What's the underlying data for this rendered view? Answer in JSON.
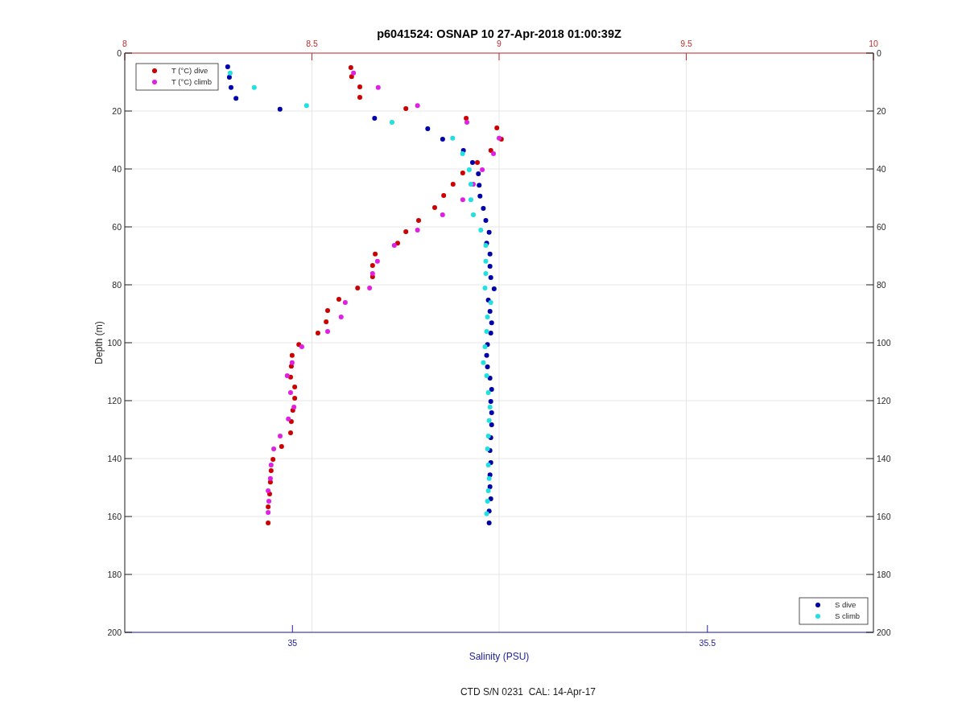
{
  "chart_data": {
    "type": "scatter",
    "grid": true,
    "legend": [
      "top-left",
      "bottom-right"
    ],
    "title": "p6041524: OSNAP 10 27-Apr-2018 01:00:39Z",
    "xlabel": "Salinity (PSU)",
    "ylabel": "Depth (m)",
    "xlim": [
      34.798,
      35.7
    ],
    "x2lim": [
      8,
      10
    ],
    "ylim": [
      200,
      0
    ],
    "xticks": [
      35,
      35.5
    ],
    "x2ticks": [
      8,
      8.5,
      9,
      9.5,
      10
    ],
    "yticks": [
      0,
      20,
      40,
      60,
      80,
      100,
      120,
      140,
      160,
      180,
      200
    ],
    "y2lim": [
      200,
      0
    ],
    "y2ticks": [
      0,
      20,
      40,
      60,
      80,
      100,
      120,
      140,
      160,
      180,
      200
    ],
    "series": [
      {
        "name": "T (°C) dive",
        "color": "#cc0000",
        "axis": "x2",
        "x": [
          8.604,
          8.606,
          8.628,
          8.628,
          8.751,
          8.912,
          8.994,
          9.006,
          8.978,
          8.942,
          8.903,
          8.877,
          8.852,
          8.828,
          8.785,
          8.751,
          8.729,
          8.669,
          8.662,
          8.662,
          8.622,
          8.572,
          8.542,
          8.538,
          8.516,
          8.465,
          8.447,
          8.445,
          8.443,
          8.454,
          8.454,
          8.449,
          8.445,
          8.443,
          8.419,
          8.396,
          8.391,
          8.389,
          8.387,
          8.383,
          8.383
        ],
        "values": [
          5.0,
          8.1,
          11.7,
          15.3,
          19.2,
          22.5,
          25.8,
          29.7,
          33.6,
          37.8,
          41.4,
          45.3,
          49.2,
          53.3,
          57.8,
          61.7,
          65.6,
          69.4,
          73.3,
          77.2,
          81.1,
          85.0,
          88.9,
          92.8,
          96.7,
          100.6,
          104.4,
          108.1,
          111.9,
          115.3,
          119.2,
          123.3,
          127.2,
          131.1,
          135.8,
          140.3,
          144.2,
          148.1,
          152.2,
          156.7,
          162.2
        ]
      },
      {
        "name": "T (°C) climb",
        "color": "#e020e0",
        "axis": "x2",
        "x": [
          8.611,
          8.677,
          8.782,
          8.914,
          9.0,
          8.985,
          8.955,
          8.931,
          8.903,
          8.849,
          8.782,
          8.72,
          8.675,
          8.662,
          8.654,
          8.589,
          8.578,
          8.542,
          8.473,
          8.447,
          8.434,
          8.443,
          8.452,
          8.437,
          8.415,
          8.398,
          8.391,
          8.389,
          8.383,
          8.385,
          8.383
        ],
        "values": [
          6.9,
          11.9,
          18.1,
          23.9,
          29.4,
          34.7,
          40.3,
          45.3,
          50.6,
          55.8,
          61.1,
          66.4,
          71.9,
          76.1,
          81.1,
          86.1,
          91.1,
          96.1,
          101.4,
          106.9,
          111.4,
          117.2,
          122.2,
          126.3,
          132.2,
          136.7,
          142.2,
          146.9,
          151.1,
          154.7,
          158.6
        ]
      },
      {
        "name": "S dive",
        "color": "#0000aa",
        "x": [
          34.922,
          34.924,
          34.926,
          34.932,
          34.985,
          35.099,
          35.163,
          35.181,
          35.206,
          35.217,
          35.224,
          35.225,
          35.226,
          35.23,
          35.233,
          35.237,
          35.234,
          35.238,
          35.238,
          35.239,
          35.243,
          35.236,
          35.238,
          35.24,
          35.239,
          35.235,
          35.234,
          35.235,
          35.238,
          35.24,
          35.239,
          35.24,
          35.24,
          35.239,
          35.238,
          35.239,
          35.238,
          35.238,
          35.239,
          35.237,
          35.237
        ],
        "values": [
          4.7,
          8.3,
          11.9,
          15.6,
          19.4,
          22.5,
          26.1,
          29.7,
          33.6,
          37.8,
          41.7,
          45.6,
          49.4,
          53.6,
          57.8,
          61.9,
          65.6,
          69.4,
          73.6,
          77.5,
          81.4,
          85.3,
          89.2,
          93.1,
          96.7,
          100.6,
          104.4,
          108.3,
          112.2,
          116.1,
          120.3,
          124.2,
          128.3,
          132.8,
          137.2,
          141.4,
          145.6,
          149.7,
          153.9,
          158.1,
          162.2
        ]
      },
      {
        "name": "S climb",
        "color": "#20e0e0",
        "x": [
          34.925,
          34.954,
          35.017,
          35.12,
          35.193,
          35.205,
          35.213,
          35.215,
          35.215,
          35.218,
          35.227,
          35.233,
          35.233,
          35.233,
          35.232,
          35.239,
          35.235,
          35.234,
          35.232,
          35.23,
          35.234,
          35.236,
          35.238,
          35.237,
          35.236,
          35.235,
          35.236,
          35.237,
          35.236,
          35.235,
          35.234
        ],
        "values": [
          6.9,
          11.9,
          18.1,
          23.9,
          29.4,
          34.7,
          40.3,
          45.3,
          50.6,
          55.8,
          61.1,
          66.4,
          71.9,
          76.1,
          81.1,
          86.1,
          91.1,
          96.1,
          101.4,
          106.9,
          111.4,
          117.2,
          122.2,
          126.9,
          132.2,
          136.7,
          142.2,
          146.9,
          151.1,
          154.7,
          159.0
        ]
      }
    ]
  },
  "footer": "CTD S/N 0231  CAL: 14-Apr-17"
}
